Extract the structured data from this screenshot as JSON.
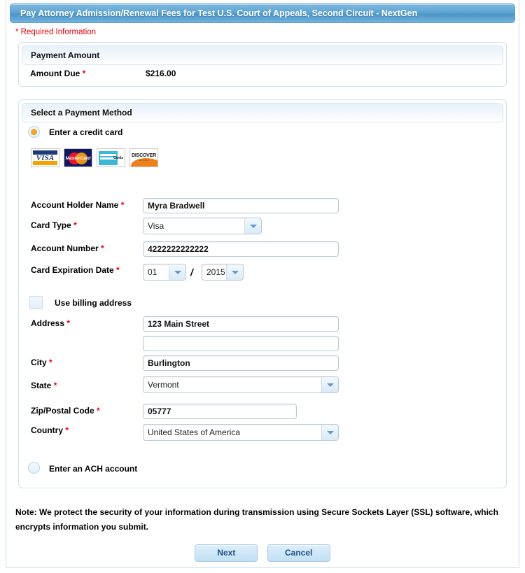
{
  "window": {
    "title": "Pay Attorney Admission/Renewal Fees for Test U.S. Court of Appeals, Second Circuit - NextGen"
  },
  "required_note": "* Required Information",
  "required_marker": "*",
  "payment_amount_panel": {
    "header": "Payment Amount",
    "amount_due_label": "Amount Due",
    "amount_due_value": "$216.00"
  },
  "payment_method_panel": {
    "header": "Select a Payment Method",
    "credit_card_option": "Enter a credit card",
    "ach_option": "Enter an ACH account",
    "accepted_cards": [
      {
        "name": "visa-logo",
        "label": "VISA"
      },
      {
        "name": "mastercard-logo",
        "label": "MasterCard"
      },
      {
        "name": "amex-logo",
        "label": "AMERICAN EXPRESS",
        "sub": "Cards"
      },
      {
        "name": "discover-logo",
        "label": "DISCOVER",
        "sub": "NETWORK"
      }
    ],
    "fields": {
      "account_holder_name": {
        "label": "Account Holder Name",
        "value": "Myra Bradwell"
      },
      "card_type": {
        "label": "Card Type",
        "value": "Visa"
      },
      "account_number": {
        "label": "Account Number",
        "value": "4222222222222"
      },
      "card_expiration_date": {
        "label": "Card Expiration Date",
        "month": "01",
        "separator": "/",
        "year": "2015"
      },
      "use_billing_address": {
        "label": "Use billing address",
        "checked": false
      },
      "address": {
        "label": "Address",
        "line1": "123 Main Street",
        "line2": ""
      },
      "city": {
        "label": "City",
        "value": "Burlington"
      },
      "state": {
        "label": "State",
        "value": "Vermont"
      },
      "zip": {
        "label": "Zip/Postal Code",
        "value": "05777"
      },
      "country": {
        "label": "Country",
        "value": "United States of America"
      }
    }
  },
  "security_note": "Note: We protect the security of your information during transmission using Secure Sockets Layer (SSL) software, which encrypts information you submit.",
  "actions": {
    "next": "Next",
    "cancel": "Cancel"
  },
  "colors": {
    "title_bar": "#5fa5d3",
    "required_red": "#e8000b",
    "panel_border": "#cfe0ee",
    "radio_dot": "#f5a623",
    "button_text": "#1b4f85"
  }
}
